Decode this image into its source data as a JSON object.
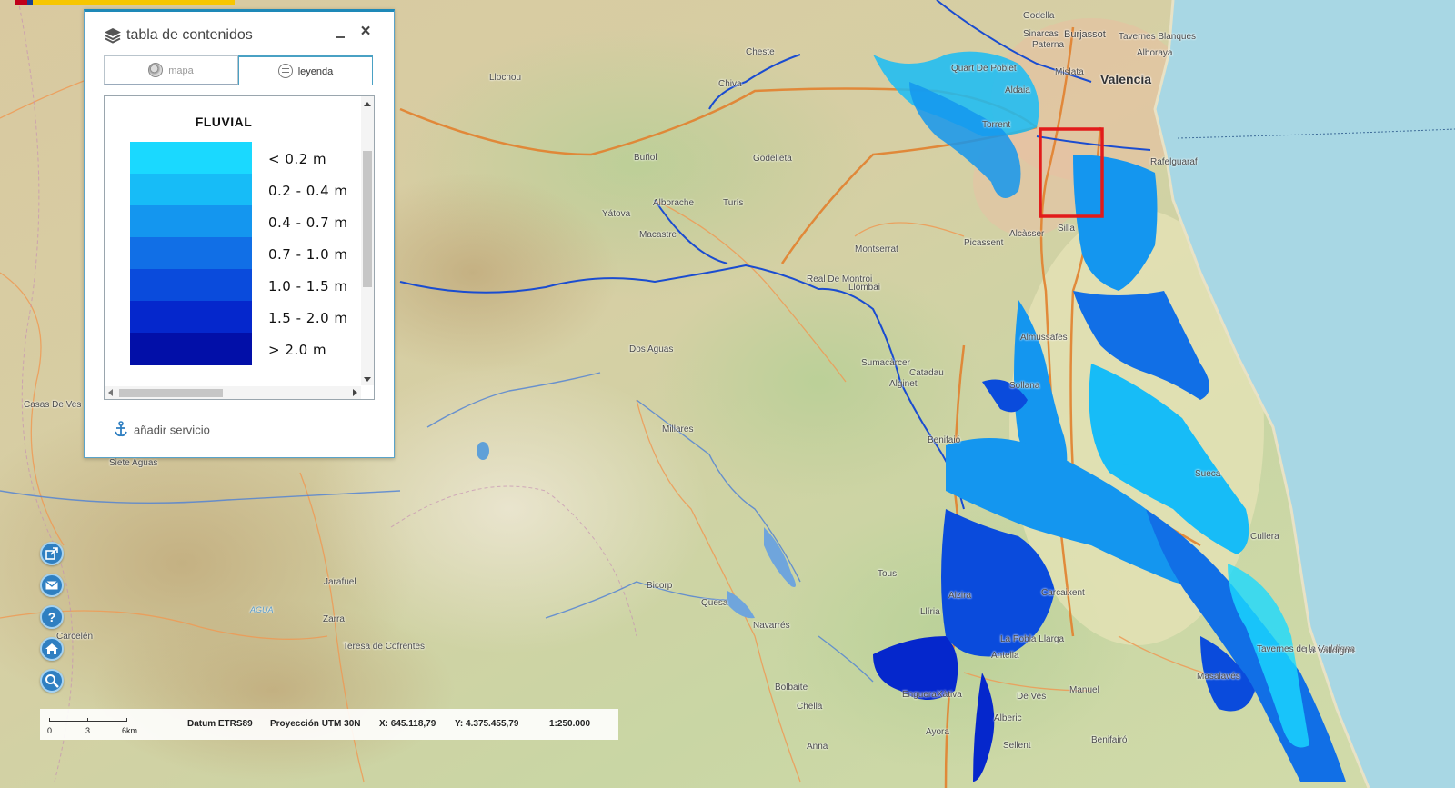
{
  "toc": {
    "title": "tabla de contenidos",
    "tabs": [
      {
        "label": "mapa",
        "active": false
      },
      {
        "label": "leyenda",
        "active": true
      }
    ],
    "legend": {
      "title": "FLUVIAL",
      "items": [
        {
          "label": "< 0.2 m",
          "color": "#1ad9ff"
        },
        {
          "label": "0.2 - 0.4 m",
          "color": "#17bcf7"
        },
        {
          "label": "0.4 - 0.7 m",
          "color": "#1496ef"
        },
        {
          "label": "0.7 - 1.0 m",
          "color": "#116fe6"
        },
        {
          "label": "1.0 - 1.5 m",
          "color": "#0a4bdc"
        },
        {
          "label": "1.5 - 2.0 m",
          "color": "#0527cc"
        },
        {
          "label": "> 2.0 m",
          "color": "#020fa8"
        }
      ]
    },
    "add_service": "añadir servicio"
  },
  "tools": [
    "share-icon",
    "mail-icon",
    "help-icon",
    "home-icon",
    "zoom-icon"
  ],
  "status": {
    "scale_labels": [
      "0",
      "3",
      "6km"
    ],
    "datum": "Datum ETRS89",
    "projection": "Proyección UTM 30N",
    "x": "X: 645.118,79",
    "y": "Y: 4.375.455,79",
    "scale": "1:250.000"
  },
  "map": {
    "places": [
      {
        "name": "Valencia",
        "class": "city"
      },
      {
        "name": "Godella",
        "class": ""
      },
      {
        "name": "Burjassot",
        "class": "mid"
      },
      {
        "name": "Tavernes Blanques",
        "class": ""
      },
      {
        "name": "Alboraya",
        "class": ""
      },
      {
        "name": "Paterna",
        "class": ""
      },
      {
        "name": "Mislata",
        "class": ""
      },
      {
        "name": "Quart De Poblet",
        "class": ""
      },
      {
        "name": "Aldaia",
        "class": ""
      },
      {
        "name": "Torrent",
        "class": ""
      },
      {
        "name": "Picassent",
        "class": ""
      },
      {
        "name": "Alcàsser",
        "class": ""
      },
      {
        "name": "Silla",
        "class": ""
      },
      {
        "name": "Cheste",
        "class": ""
      },
      {
        "name": "Chiva",
        "class": ""
      },
      {
        "name": "Buñol",
        "class": ""
      },
      {
        "name": "Godelleta",
        "class": ""
      },
      {
        "name": "Turís",
        "class": ""
      },
      {
        "name": "Montserrat",
        "class": ""
      },
      {
        "name": "Alborache",
        "class": ""
      },
      {
        "name": "Macastre",
        "class": ""
      },
      {
        "name": "Yátova",
        "class": ""
      },
      {
        "name": "Almussafes",
        "class": ""
      },
      {
        "name": "Sollana",
        "class": ""
      },
      {
        "name": "Sueca",
        "class": ""
      },
      {
        "name": "Cullera",
        "class": ""
      },
      {
        "name": "Alzira",
        "class": ""
      },
      {
        "name": "Carcaixent",
        "class": ""
      },
      {
        "name": "La Pobla Llarga",
        "class": ""
      },
      {
        "name": "Tous",
        "class": ""
      },
      {
        "name": "Navarrés",
        "class": ""
      },
      {
        "name": "Bicorp",
        "class": ""
      },
      {
        "name": "Quesa",
        "class": ""
      },
      {
        "name": "Millares",
        "class": ""
      },
      {
        "name": "Tavernes de la Valldigna",
        "class": ""
      },
      {
        "name": "La Valldigna",
        "class": ""
      },
      {
        "name": "Xàtiva",
        "class": ""
      },
      {
        "name": "Chella",
        "class": ""
      },
      {
        "name": "Anna",
        "class": ""
      },
      {
        "name": "Bolbaite",
        "class": ""
      },
      {
        "name": "Enguera",
        "class": ""
      },
      {
        "name": "Casas De Ves",
        "class": ""
      },
      {
        "name": "Ayora",
        "class": ""
      },
      {
        "name": "Jarafuel",
        "class": ""
      },
      {
        "name": "Zarra",
        "class": ""
      },
      {
        "name": "Teresa de Cofrentes",
        "class": ""
      },
      {
        "name": "Carcelén",
        "class": ""
      },
      {
        "name": "AGUA",
        "class": "river"
      },
      {
        "name": "Dos Aguas",
        "class": ""
      },
      {
        "name": "Real De Montroi",
        "class": ""
      },
      {
        "name": "Llombai",
        "class": ""
      },
      {
        "name": "Catadau",
        "class": ""
      },
      {
        "name": "Alginet",
        "class": ""
      },
      {
        "name": "Benifaió",
        "class": ""
      },
      {
        "name": "Sumacàrcer",
        "class": ""
      },
      {
        "name": "Antella",
        "class": ""
      },
      {
        "name": "Manuel",
        "class": ""
      },
      {
        "name": "Alberic",
        "class": ""
      },
      {
        "name": "Benifairó",
        "class": ""
      },
      {
        "name": "Sellent",
        "class": ""
      },
      {
        "name": "Barxeta",
        "class": ""
      },
      {
        "name": "Llocnou",
        "class": ""
      },
      {
        "name": "Sinarcas",
        "class": ""
      },
      {
        "name": "Siete Aguas",
        "class": ""
      },
      {
        "name": "Llíria",
        "class": ""
      },
      {
        "name": "De Ves",
        "class": ""
      },
      {
        "name": "Masalavés",
        "class": ""
      },
      {
        "name": "Rafelguaraf",
        "class": ""
      },
      {
        "name": "Corbera",
        "class": ""
      },
      {
        "name": "Pueblo Nuevo",
        "class": ""
      }
    ]
  }
}
